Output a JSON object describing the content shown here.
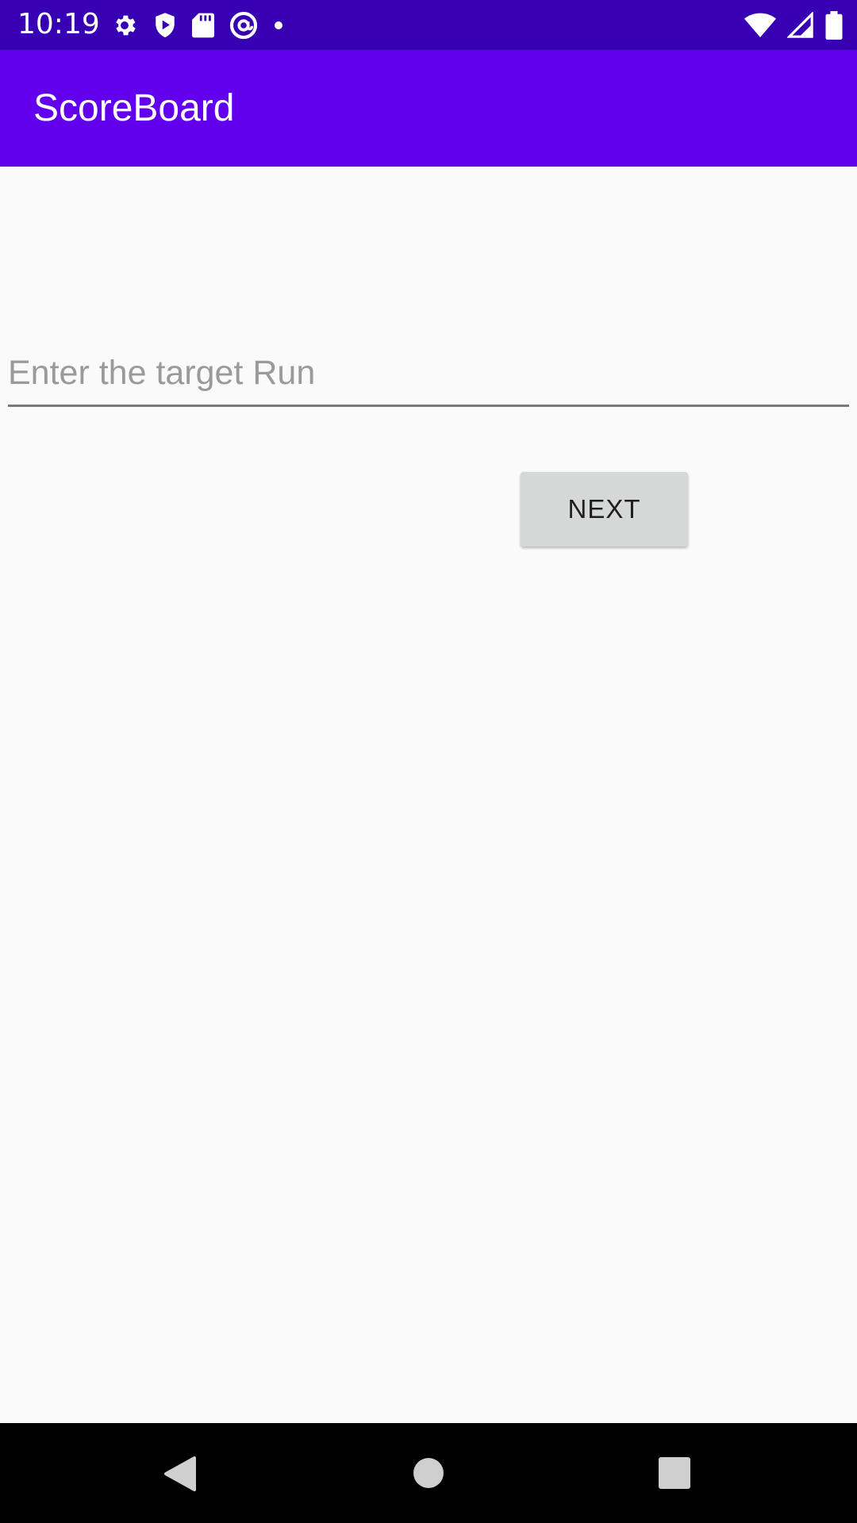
{
  "status_bar": {
    "time": "10:19",
    "left_icons": [
      "settings-icon",
      "shield-play-icon",
      "sd-card-icon",
      "sync-at-icon",
      "dot-icon"
    ],
    "right_icons": [
      "wifi-icon",
      "cell-signal-icon",
      "battery-icon"
    ],
    "background": "#3700b3"
  },
  "app_bar": {
    "title": "ScoreBoard",
    "background": "#6200ee"
  },
  "form": {
    "target_input_value": "",
    "target_input_placeholder": "Enter the target Run",
    "next_label": "NEXT"
  },
  "nav_bar": {
    "icons": [
      "back-icon",
      "home-icon",
      "recents-icon"
    ]
  }
}
